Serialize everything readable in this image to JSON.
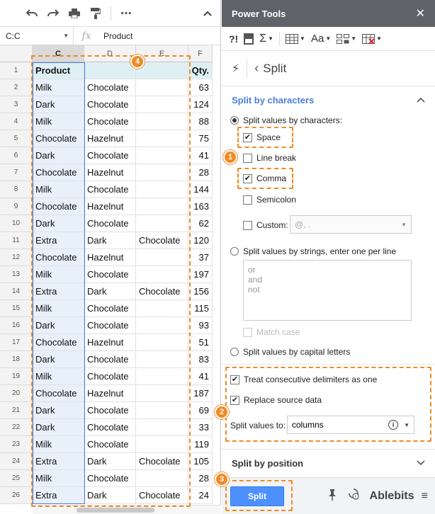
{
  "sheet": {
    "namebox": "C:C",
    "fx_label": "fx",
    "formula": "Product",
    "columns": [
      "C",
      "D",
      "E",
      "F"
    ],
    "rows": [
      {
        "n": "1",
        "c": "Product",
        "d": "",
        "e": "",
        "f": "Qty."
      },
      {
        "n": "2",
        "c": "Milk",
        "d": "Chocolate",
        "e": "",
        "f": "63"
      },
      {
        "n": "3",
        "c": "Dark",
        "d": "Chocolate",
        "e": "",
        "f": "124"
      },
      {
        "n": "4",
        "c": "Milk",
        "d": "Chocolate",
        "e": "",
        "f": "88"
      },
      {
        "n": "5",
        "c": "Chocolate",
        "d": "Hazelnut",
        "e": "",
        "f": "75"
      },
      {
        "n": "6",
        "c": "Dark",
        "d": "Chocolate",
        "e": "",
        "f": "41"
      },
      {
        "n": "7",
        "c": "Chocolate",
        "d": "Hazelnut",
        "e": "",
        "f": "28"
      },
      {
        "n": "8",
        "c": "Milk",
        "d": "Chocolate",
        "e": "",
        "f": "144"
      },
      {
        "n": "9",
        "c": "Chocolate",
        "d": "Hazelnut",
        "e": "",
        "f": "163"
      },
      {
        "n": "10",
        "c": "Dark",
        "d": "Chocolate",
        "e": "",
        "f": "62"
      },
      {
        "n": "11",
        "c": "Extra",
        "d": "Dark",
        "e": "Chocolate",
        "f": "120"
      },
      {
        "n": "12",
        "c": "Chocolate",
        "d": "Hazelnut",
        "e": "",
        "f": "37"
      },
      {
        "n": "13",
        "c": "Milk",
        "d": "Chocolate",
        "e": "",
        "f": "197"
      },
      {
        "n": "14",
        "c": "Extra",
        "d": "Dark",
        "e": "Chocolate",
        "f": "156"
      },
      {
        "n": "15",
        "c": "Milk",
        "d": "Chocolate",
        "e": "",
        "f": "115"
      },
      {
        "n": "16",
        "c": "Dark",
        "d": "Chocolate",
        "e": "",
        "f": "93"
      },
      {
        "n": "17",
        "c": "Chocolate",
        "d": "Hazelnut",
        "e": "",
        "f": "51"
      },
      {
        "n": "18",
        "c": "Dark",
        "d": "Chocolate",
        "e": "",
        "f": "83"
      },
      {
        "n": "19",
        "c": "Milk",
        "d": "Chocolate",
        "e": "",
        "f": "41"
      },
      {
        "n": "20",
        "c": "Chocolate",
        "d": "Hazelnut",
        "e": "",
        "f": "187"
      },
      {
        "n": "21",
        "c": "Dark",
        "d": "Chocolate",
        "e": "",
        "f": "69"
      },
      {
        "n": "22",
        "c": "Dark",
        "d": "Chocolate",
        "e": "",
        "f": "33"
      },
      {
        "n": "23",
        "c": "Milk",
        "d": "Chocolate",
        "e": "",
        "f": "119"
      },
      {
        "n": "24",
        "c": "Extra",
        "d": "Dark",
        "e": "Chocolate",
        "f": "105"
      },
      {
        "n": "25",
        "c": "Milk",
        "d": "Chocolate",
        "e": "",
        "f": "28"
      },
      {
        "n": "26",
        "c": "Extra",
        "d": "Dark",
        "e": "Chocolate",
        "f": "24"
      }
    ]
  },
  "panel": {
    "title": "Power Tools",
    "nav_title": "Split",
    "section1_title": "Split by characters",
    "radio_chars": "Split values by characters:",
    "chk_space": "Space",
    "chk_linebreak": "Line break",
    "chk_comma": "Comma",
    "chk_semicolon": "Semicolon",
    "chk_custom": "Custom:",
    "custom_placeholder": "@, .",
    "radio_strings": "Split values by strings, enter one per line",
    "strings_lines": [
      "or",
      "and",
      "not"
    ],
    "chk_matchcase": "Match case",
    "radio_capital": "Split values by capital letters",
    "chk_consecutive": "Treat consecutive delimiters as one",
    "chk_replace": "Replace source data",
    "split_to_label": "Split values to:",
    "split_to_value": "columns",
    "section2_title": "Split by position",
    "split_button": "Split",
    "brand": "Ablebits"
  },
  "badges": [
    "1",
    "2",
    "3",
    "4"
  ],
  "colors": {
    "accent": "#f08a24",
    "header_bar": "#5f6368",
    "button": "#4d90fe"
  }
}
